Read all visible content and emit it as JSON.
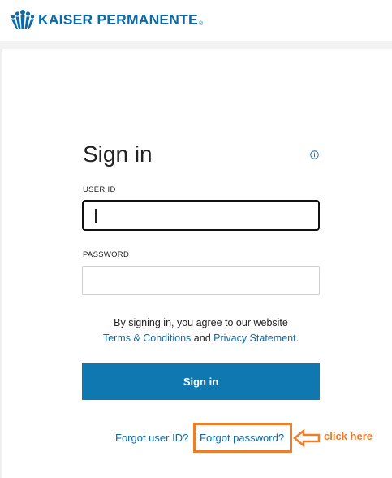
{
  "brand": {
    "name": "KAISER PERMANENTE",
    "registered": "®",
    "color": "#0d6aa6"
  },
  "signin": {
    "title": "Sign in",
    "user_id_label": "USER ID",
    "password_label": "PASSWORD",
    "user_id_value": "",
    "password_value": "",
    "legal_prefix": "By signing in, you agree to our website",
    "terms_link": "Terms & Conditions",
    "legal_and": "and",
    "privacy_link": "Privacy Statement",
    "legal_suffix": ".",
    "button_label": "Sign in",
    "button_color": "#0f78b0",
    "forgot_user_label": "Forgot user ID?",
    "forgot_password_label": "Forgot password?"
  },
  "annotation": {
    "label": "click here",
    "color": "#ef7d27"
  },
  "icons": [
    "kaiser-logo-icon",
    "info-icon",
    "arrow-left-icon"
  ]
}
